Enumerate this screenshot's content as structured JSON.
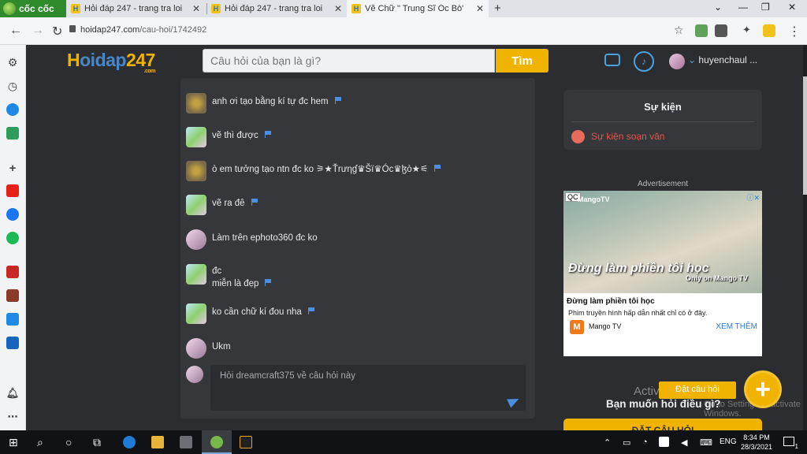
{
  "browser": {
    "brand": "cốc cốc",
    "tabs": [
      {
        "title": "Hỏi đáp 247 - trang tra loi",
        "active": false
      },
      {
        "title": "Hỏi đáp 247 - trang tra loi",
        "active": false
      },
      {
        "title": "Vẽ Chữ \" Trung Sĩ Óc Bò\" để làm",
        "active": true
      }
    ],
    "url_domain": "hoidap247.com",
    "url_path": "/cau-hoi/1742492"
  },
  "site": {
    "logo_h": "H",
    "logo_oidap": "oidap",
    "logo_num": "247",
    "logo_com": ".com",
    "search_placeholder": "Câu hỏi của bạn là gì?",
    "search_button": "Tìm",
    "username": "huyenchaul ..."
  },
  "comments": [
    {
      "avatar": "a",
      "text": "anh ơi tạo bằng kí tự đc hem",
      "flag": true
    },
    {
      "avatar": "b",
      "text": "vẽ thì được",
      "flag": true
    },
    {
      "avatar": "a",
      "text": "ò em tưởng tạo ntn đc ko ⚞★Ťrưηɠ♛Šï♛Óc♛ɮò★⚟",
      "flag": true
    },
    {
      "avatar": "b",
      "text": "vẽ ra đê",
      "flag": true
    },
    {
      "avatar": "c",
      "text": "Làm trên ephoto360 đc ko",
      "flag": false
    },
    {
      "avatar": "b",
      "text": "đc",
      "text2": "miễn là đẹp",
      "flag": true
    },
    {
      "avatar": "b",
      "text": "ko cần chữ kí đou nha",
      "flag": true
    },
    {
      "avatar": "c",
      "text": "Ukm",
      "flag": false
    }
  ],
  "reply_placeholder": "Hỏi dreamcraft375 về câu hỏi này",
  "events": {
    "title": "Sự kiện",
    "link": "Sự kiện soạn văn"
  },
  "ad": {
    "label": "Advertisement",
    "qc": "QC",
    "brand_top": "MangoTV",
    "title_overlay": "Đừng làm phiền tôi học",
    "only_on": "Only on Mango TV",
    "headline": "Đừng làm phiền tôi học",
    "subtext": "Phim truyền hình hấp dẫn nhất chỉ có ở đây.",
    "brand": "Mango TV",
    "cta": "XEM THÊM"
  },
  "right": {
    "activate": "Activate",
    "activate_sub": "Go to Settings to activate Windows.",
    "ask_title": "Bạn muốn hỏi điều gì?",
    "ask_button": "ĐẶT CÂU HỎI",
    "fab_tooltip": "Đặt câu hỏi",
    "fab_icon": "+"
  },
  "taskbar": {
    "ime": "ENG",
    "time": "8:34 PM",
    "date": "28/3/2021",
    "notif_count": "1"
  },
  "colors": {
    "accent": "#f0b400",
    "link_blue": "#4a8fe0",
    "page_bg": "#2b2d31",
    "panel_bg": "#35373b",
    "event_red": "#e8554b"
  }
}
